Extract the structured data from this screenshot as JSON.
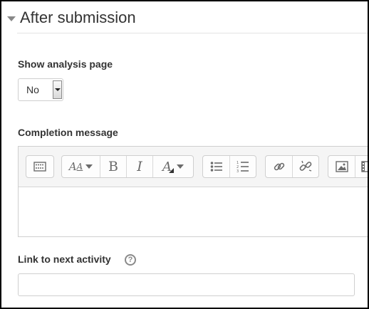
{
  "section": {
    "title": "After submission"
  },
  "analysis": {
    "label": "Show analysis page",
    "selected": "No"
  },
  "completion": {
    "label": "Completion message",
    "content": ""
  },
  "next_activity": {
    "label": "Link to next activity",
    "help": "?",
    "value": ""
  },
  "toolbar": {
    "font_size_icon": "A",
    "bold_icon": "B",
    "italic_icon": "I",
    "font_color_icon": "A"
  }
}
